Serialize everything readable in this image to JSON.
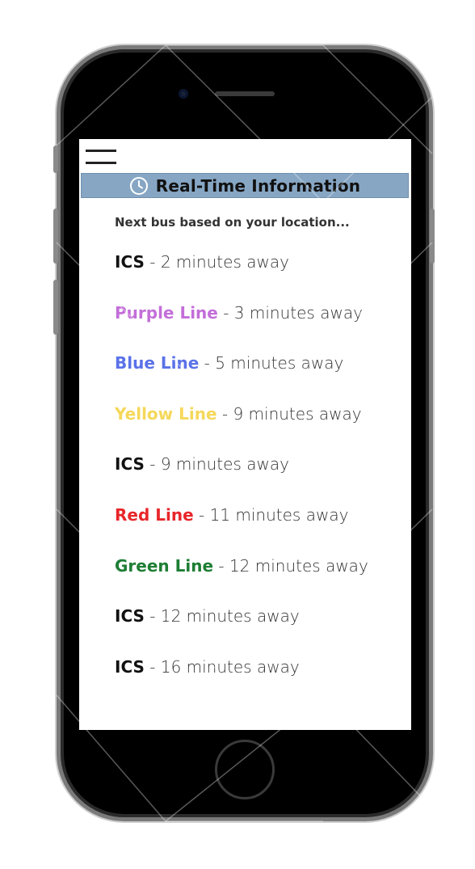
{
  "header": {
    "title": "Real-Time Information",
    "icon": "clock-icon"
  },
  "menu": {
    "icon": "hamburger-menu-icon"
  },
  "subtitle": "Next bus based on your location...",
  "arrivals": [
    {
      "line": "ICS",
      "eta": " - 2 minutes away",
      "color": "#111111"
    },
    {
      "line": "Purple Line",
      "eta": " - 3 minutes away",
      "color": "#c36ed9"
    },
    {
      "line": "Blue Line",
      "eta": " - 5 minutes away",
      "color": "#5a72e8"
    },
    {
      "line": "Yellow Line",
      "eta": " - 9 minutes away",
      "color": "#f5d85a"
    },
    {
      "line": "ICS",
      "eta": " - 9 minutes away",
      "color": "#111111"
    },
    {
      "line": "Red Line",
      "eta": " - 11 minutes away",
      "color": "#e8262a"
    },
    {
      "line": "Green Line",
      "eta": " - 12 minutes away",
      "color": "#1e7e34"
    },
    {
      "line": "ICS",
      "eta": " - 12 minutes away",
      "color": "#111111"
    },
    {
      "line": "ICS",
      "eta": " - 16 minutes away",
      "color": "#111111"
    }
  ],
  "colors": {
    "header_bar": "#86a6c4",
    "phone_body": "#000000",
    "screen_background": "#ffffff"
  }
}
